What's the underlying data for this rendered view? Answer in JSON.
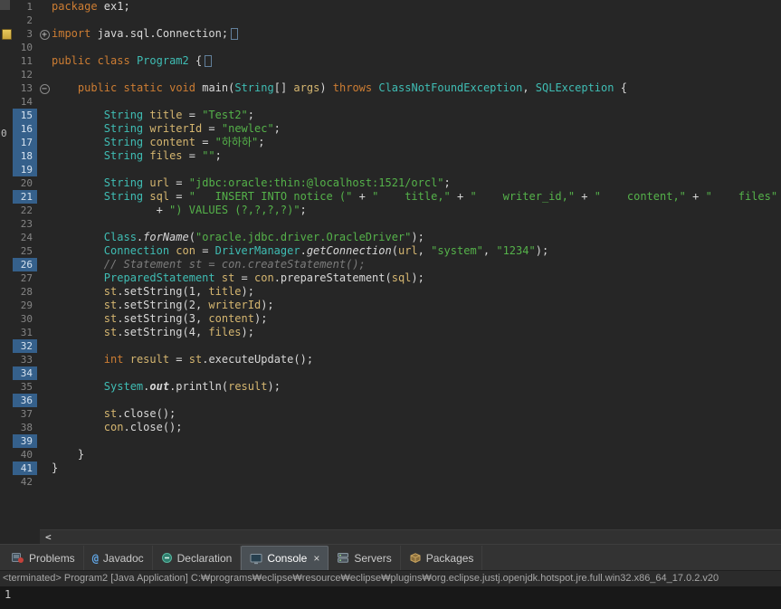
{
  "palette": {
    "editor_bg": "#262626",
    "keyword": "#cd7d33",
    "type": "#3fbdb4",
    "string": "#55b24a",
    "variable": "#d5b670",
    "comment": "#7c7c7c",
    "default_text": "#d8d8d8",
    "line_number": "#858585",
    "changed_line_bg": "#35608b",
    "tabbar_bg": "#333333",
    "tab_active_bg": "#4a5055",
    "console_bg": "#181818"
  },
  "editor": {
    "edge_artifact": "0",
    "scrollbar_left_glyph": "<",
    "lines": [
      {
        "num": "1",
        "seg": [
          [
            "kw",
            "package"
          ],
          [
            "pl",
            " ex1;"
          ]
        ]
      },
      {
        "num": "2",
        "seg": []
      },
      {
        "num": "3",
        "fold": "plus",
        "marker": true,
        "seg": [
          [
            "kw",
            "import"
          ],
          [
            "pl",
            " java.sql.Connection;"
          ],
          [
            "box",
            ""
          ]
        ]
      },
      {
        "num": "10",
        "seg": []
      },
      {
        "num": "11",
        "seg": [
          [
            "kw",
            "public"
          ],
          [
            "pl",
            " "
          ],
          [
            "kw",
            "class"
          ],
          [
            "pl",
            " "
          ],
          [
            "cls",
            "Program2"
          ],
          [
            "pl",
            " {"
          ],
          [
            "box",
            ""
          ]
        ]
      },
      {
        "num": "12",
        "seg": []
      },
      {
        "num": "13",
        "fold": "minus",
        "seg": [
          [
            "pl",
            "    "
          ],
          [
            "kw",
            "public"
          ],
          [
            "pl",
            " "
          ],
          [
            "kw",
            "static"
          ],
          [
            "pl",
            " "
          ],
          [
            "kw",
            "void"
          ],
          [
            "pl",
            " main("
          ],
          [
            "cls",
            "String"
          ],
          [
            "pl",
            "[] "
          ],
          [
            "var",
            "args"
          ],
          [
            "pl",
            ") "
          ],
          [
            "kw",
            "throws"
          ],
          [
            "pl",
            " "
          ],
          [
            "cls",
            "ClassNotFoundException"
          ],
          [
            "pl",
            ", "
          ],
          [
            "cls",
            "SQLException"
          ],
          [
            "pl",
            " {"
          ]
        ]
      },
      {
        "num": "14",
        "seg": []
      },
      {
        "num": "15",
        "chg": true,
        "seg": [
          [
            "pl",
            "        "
          ],
          [
            "cls",
            "String"
          ],
          [
            "pl",
            " "
          ],
          [
            "var",
            "title"
          ],
          [
            "pl",
            " = "
          ],
          [
            "str",
            "\"Test2\""
          ],
          [
            "pl",
            ";"
          ]
        ]
      },
      {
        "num": "16",
        "chg": true,
        "seg": [
          [
            "pl",
            "        "
          ],
          [
            "cls",
            "String"
          ],
          [
            "pl",
            " "
          ],
          [
            "var",
            "writerId"
          ],
          [
            "pl",
            " = "
          ],
          [
            "str",
            "\"newlec\""
          ],
          [
            "pl",
            ";"
          ]
        ]
      },
      {
        "num": "17",
        "chg": true,
        "seg": [
          [
            "pl",
            "        "
          ],
          [
            "cls",
            "String"
          ],
          [
            "pl",
            " "
          ],
          [
            "var",
            "content"
          ],
          [
            "pl",
            " = "
          ],
          [
            "str",
            "\"하하하\""
          ],
          [
            "pl",
            ";"
          ]
        ]
      },
      {
        "num": "18",
        "chg": true,
        "seg": [
          [
            "pl",
            "        "
          ],
          [
            "cls",
            "String"
          ],
          [
            "pl",
            " "
          ],
          [
            "var",
            "files"
          ],
          [
            "pl",
            " = "
          ],
          [
            "str",
            "\"\""
          ],
          [
            "pl",
            ";"
          ]
        ]
      },
      {
        "num": "19",
        "chg": true,
        "seg": []
      },
      {
        "num": "20",
        "seg": [
          [
            "pl",
            "        "
          ],
          [
            "cls",
            "String"
          ],
          [
            "pl",
            " "
          ],
          [
            "var",
            "url"
          ],
          [
            "pl",
            " = "
          ],
          [
            "str",
            "\"jdbc:oracle:thin:@localhost:1521/orcl\""
          ],
          [
            "pl",
            ";"
          ]
        ]
      },
      {
        "num": "21",
        "chg": true,
        "seg": [
          [
            "pl",
            "        "
          ],
          [
            "cls",
            "String"
          ],
          [
            "pl",
            " "
          ],
          [
            "var",
            "sql"
          ],
          [
            "pl",
            " = "
          ],
          [
            "str",
            "\"   INSERT INTO notice (\""
          ],
          [
            "pl",
            " + "
          ],
          [
            "str",
            "\"    title,\""
          ],
          [
            "pl",
            " + "
          ],
          [
            "str",
            "\"    writer_id,\""
          ],
          [
            "pl",
            " + "
          ],
          [
            "str",
            "\"    content,\""
          ],
          [
            "pl",
            " + "
          ],
          [
            "str",
            "\"    files\""
          ]
        ]
      },
      {
        "num": "22",
        "seg": [
          [
            "pl",
            "                + "
          ],
          [
            "str",
            "\") VALUES (?,?,?,?)\""
          ],
          [
            "pl",
            ";"
          ]
        ]
      },
      {
        "num": "23",
        "seg": []
      },
      {
        "num": "24",
        "seg": [
          [
            "pl",
            "        "
          ],
          [
            "cls",
            "Class"
          ],
          [
            "pl",
            "."
          ],
          [
            "itl",
            "forName"
          ],
          [
            "pl",
            "("
          ],
          [
            "str",
            "\"oracle.jdbc.driver.OracleDriver\""
          ],
          [
            "pl",
            ");"
          ]
        ]
      },
      {
        "num": "25",
        "seg": [
          [
            "pl",
            "        "
          ],
          [
            "cls",
            "Connection"
          ],
          [
            "pl",
            " "
          ],
          [
            "var",
            "con"
          ],
          [
            "pl",
            " = "
          ],
          [
            "cls",
            "DriverManager"
          ],
          [
            "pl",
            "."
          ],
          [
            "itl",
            "getConnection"
          ],
          [
            "pl",
            "("
          ],
          [
            "var",
            "url"
          ],
          [
            "pl",
            ", "
          ],
          [
            "str",
            "\"system\""
          ],
          [
            "pl",
            ", "
          ],
          [
            "str",
            "\"1234\""
          ],
          [
            "pl",
            ");"
          ]
        ]
      },
      {
        "num": "26",
        "chg": true,
        "seg": [
          [
            "pl",
            "        "
          ],
          [
            "cmt",
            "// Statement st = con.createStatement();"
          ]
        ]
      },
      {
        "num": "27",
        "seg": [
          [
            "pl",
            "        "
          ],
          [
            "cls",
            "PreparedStatement"
          ],
          [
            "pl",
            " "
          ],
          [
            "var",
            "st"
          ],
          [
            "pl",
            " = "
          ],
          [
            "var",
            "con"
          ],
          [
            "pl",
            ".prepareStatement("
          ],
          [
            "var",
            "sql"
          ],
          [
            "pl",
            ");"
          ]
        ]
      },
      {
        "num": "28",
        "seg": [
          [
            "pl",
            "        "
          ],
          [
            "var",
            "st"
          ],
          [
            "pl",
            ".setString(1, "
          ],
          [
            "var",
            "title"
          ],
          [
            "pl",
            ");"
          ]
        ]
      },
      {
        "num": "29",
        "seg": [
          [
            "pl",
            "        "
          ],
          [
            "var",
            "st"
          ],
          [
            "pl",
            ".setString(2, "
          ],
          [
            "var",
            "writerId"
          ],
          [
            "pl",
            ");"
          ]
        ]
      },
      {
        "num": "30",
        "seg": [
          [
            "pl",
            "        "
          ],
          [
            "var",
            "st"
          ],
          [
            "pl",
            ".setString(3, "
          ],
          [
            "var",
            "content"
          ],
          [
            "pl",
            ");"
          ]
        ]
      },
      {
        "num": "31",
        "seg": [
          [
            "pl",
            "        "
          ],
          [
            "var",
            "st"
          ],
          [
            "pl",
            ".setString(4, "
          ],
          [
            "var",
            "files"
          ],
          [
            "pl",
            ");"
          ]
        ]
      },
      {
        "num": "32",
        "chg": true,
        "seg": []
      },
      {
        "num": "33",
        "seg": [
          [
            "pl",
            "        "
          ],
          [
            "kw",
            "int"
          ],
          [
            "pl",
            " "
          ],
          [
            "var",
            "result"
          ],
          [
            "pl",
            " = "
          ],
          [
            "var",
            "st"
          ],
          [
            "pl",
            ".executeUpdate();"
          ]
        ]
      },
      {
        "num": "34",
        "chg": true,
        "seg": []
      },
      {
        "num": "35",
        "seg": [
          [
            "pl",
            "        "
          ],
          [
            "cls",
            "System"
          ],
          [
            "pl",
            "."
          ],
          [
            "fld",
            "out"
          ],
          [
            "pl",
            ".println("
          ],
          [
            "var",
            "result"
          ],
          [
            "pl",
            ");"
          ]
        ]
      },
      {
        "num": "36",
        "chg": true,
        "seg": []
      },
      {
        "num": "37",
        "seg": [
          [
            "pl",
            "        "
          ],
          [
            "var",
            "st"
          ],
          [
            "pl",
            ".close();"
          ]
        ]
      },
      {
        "num": "38",
        "seg": [
          [
            "pl",
            "        "
          ],
          [
            "var",
            "con"
          ],
          [
            "pl",
            ".close();"
          ]
        ]
      },
      {
        "num": "39",
        "chg": true,
        "seg": []
      },
      {
        "num": "40",
        "seg": [
          [
            "pl",
            "    }"
          ]
        ]
      },
      {
        "num": "41",
        "chg": true,
        "seg": [
          [
            "pl",
            "}"
          ]
        ]
      },
      {
        "num": "42",
        "seg": []
      }
    ]
  },
  "tabs": [
    {
      "label": "Problems",
      "icon": "problems-icon"
    },
    {
      "label": "Javadoc",
      "icon": "javadoc-icon"
    },
    {
      "label": "Declaration",
      "icon": "declaration-icon"
    },
    {
      "label": "Console",
      "icon": "console-icon",
      "active": true,
      "close_glyph": "×"
    },
    {
      "label": "Servers",
      "icon": "servers-icon"
    },
    {
      "label": "Packages",
      "icon": "packages-icon"
    }
  ],
  "statusline": {
    "text": "<terminated> Program2 [Java Application] C:₩programs₩eclipse₩resource₩eclipse₩plugins₩org.eclipse.justj.openjdk.hotspot.jre.full.win32.x86_64_17.0.2.v20"
  },
  "console": {
    "output": "1"
  }
}
